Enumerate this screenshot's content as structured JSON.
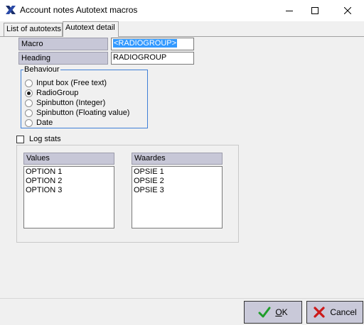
{
  "window": {
    "title": "Account notes Autotext macros",
    "minimize_icon": "minimize-icon",
    "maximize_icon": "maximize-icon",
    "close_icon": "close-icon"
  },
  "tabs": [
    {
      "label": "List of autotexts",
      "active": false
    },
    {
      "label": "Autotext detail",
      "active": true
    }
  ],
  "form": {
    "macro_label": "Macro",
    "macro_value": "<RADIOGROUP>",
    "heading_label": "Heading",
    "heading_value": "RADIOGROUP"
  },
  "behaviour": {
    "caption": "Behaviour",
    "options": [
      {
        "label": "Input box (Free text)",
        "checked": false
      },
      {
        "label": "RadioGroup",
        "checked": true
      },
      {
        "label": "Spinbutton (Integer)",
        "checked": false
      },
      {
        "label": "Spinbutton (Floating value)",
        "checked": false
      },
      {
        "label": "Date",
        "checked": false
      }
    ]
  },
  "log_stats": {
    "label": "Log stats",
    "checked": false
  },
  "values": {
    "header": "Values",
    "items": [
      "OPTION 1",
      "OPTION 2",
      "OPTION 3"
    ]
  },
  "waardes": {
    "header": "Waardes",
    "items": [
      "OPSIE 1",
      "OPSIE 2",
      "OPSIE 3"
    ]
  },
  "buttons": {
    "ok_label": "OK",
    "ok_accel": "O",
    "ok_rest": "K",
    "cancel_label": "Cancel"
  },
  "colors": {
    "label_bg": "#c7c7d7",
    "selection": "#3399ff",
    "group_border": "#3f7fd6",
    "ok_check": "#1f9d2a",
    "cancel_x": "#cc1a1a"
  }
}
